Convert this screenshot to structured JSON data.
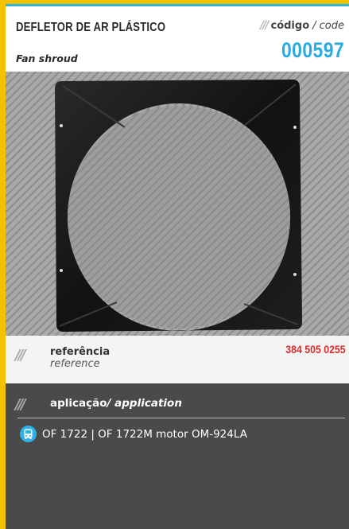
{
  "header": {
    "title": "DEFLETOR DE AR PLÁSTICO",
    "subtitle": "Fan shroud",
    "code_label_bold": "código",
    "code_label_italic": "/ code",
    "code_value": "000597"
  },
  "reference": {
    "label": "referência",
    "sublabel": "reference",
    "value": "384 505 0255"
  },
  "application": {
    "label_bold": "aplicação",
    "label_italic": "/ application",
    "items": [
      {
        "icon": "bus-icon",
        "text": "OF 1722 | OF 1722M motor OM-924LA"
      }
    ]
  },
  "photo": {
    "subject": "fan-shroud-photo"
  },
  "colors": {
    "accent_yellow": "#f2c200",
    "accent_blue": "#29abe2",
    "reference_red": "#d32f2f",
    "application_bg": "#4a4a4a"
  }
}
